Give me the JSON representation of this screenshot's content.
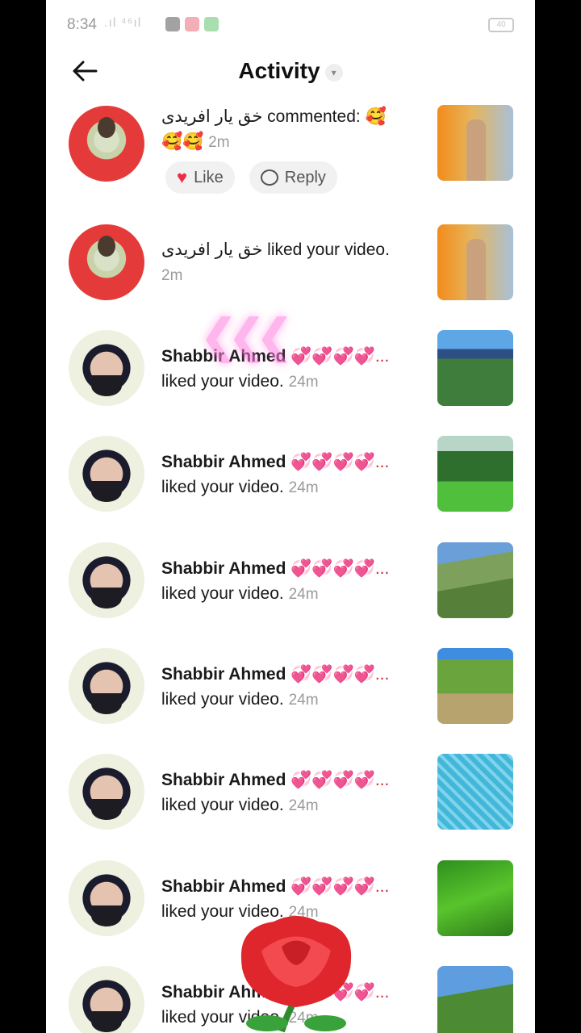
{
  "status": {
    "time": "8:34",
    "signal": ".ıl ⁴⁶ıl",
    "battery": "40"
  },
  "header": {
    "title": "Activity",
    "caret": "▾"
  },
  "items": [
    {
      "name_rtl": "خق یار افریدی",
      "line1_rest": " commented: 🥰",
      "line2": "🥰🥰 ",
      "time": "2m",
      "like_label": "Like",
      "reply_label": "Reply"
    },
    {
      "name_rtl": "خق یار افریدی",
      "line1_rest": " liked your video.",
      "time": "2m"
    },
    {
      "name": "Shabbir Ahmed",
      "emoji": " 💞💞💞💞...",
      "action": "liked your video. ",
      "time": "24m"
    },
    {
      "name": "Shabbir Ahmed",
      "emoji": " 💞💞💞💞...",
      "action": "liked your video. ",
      "time": "24m"
    },
    {
      "name": "Shabbir Ahmed",
      "emoji": " 💞💞💞💞...",
      "action": "liked your video. ",
      "time": "24m"
    },
    {
      "name": "Shabbir Ahmed",
      "emoji": " 💞💞💞💞...",
      "action": "liked your video. ",
      "time": "24m"
    },
    {
      "name": "Shabbir Ahmed",
      "emoji": " 💞💞💞💞...",
      "action": "liked your video. ",
      "time": "24m"
    },
    {
      "name": "Shabbir Ahmed",
      "emoji": " 💞💞💞💞...",
      "action": "liked your video. ",
      "time": "24m"
    },
    {
      "name": "Shabbir Ahmed",
      "emoji": " 💞💞💞💞...",
      "action": "liked your video. ",
      "time": "24m"
    }
  ],
  "icons": {
    "back": "arrow-left-icon",
    "like": "heart-icon",
    "reply": "comment-icon",
    "overlay_arrows": "chevrons-left-icon",
    "overlay_rose": "rose-icon"
  },
  "colors": {
    "like_heart": "#ee2c44",
    "time_gray": "#9a9a9a",
    "pill_bg": "#f1f1f1"
  }
}
